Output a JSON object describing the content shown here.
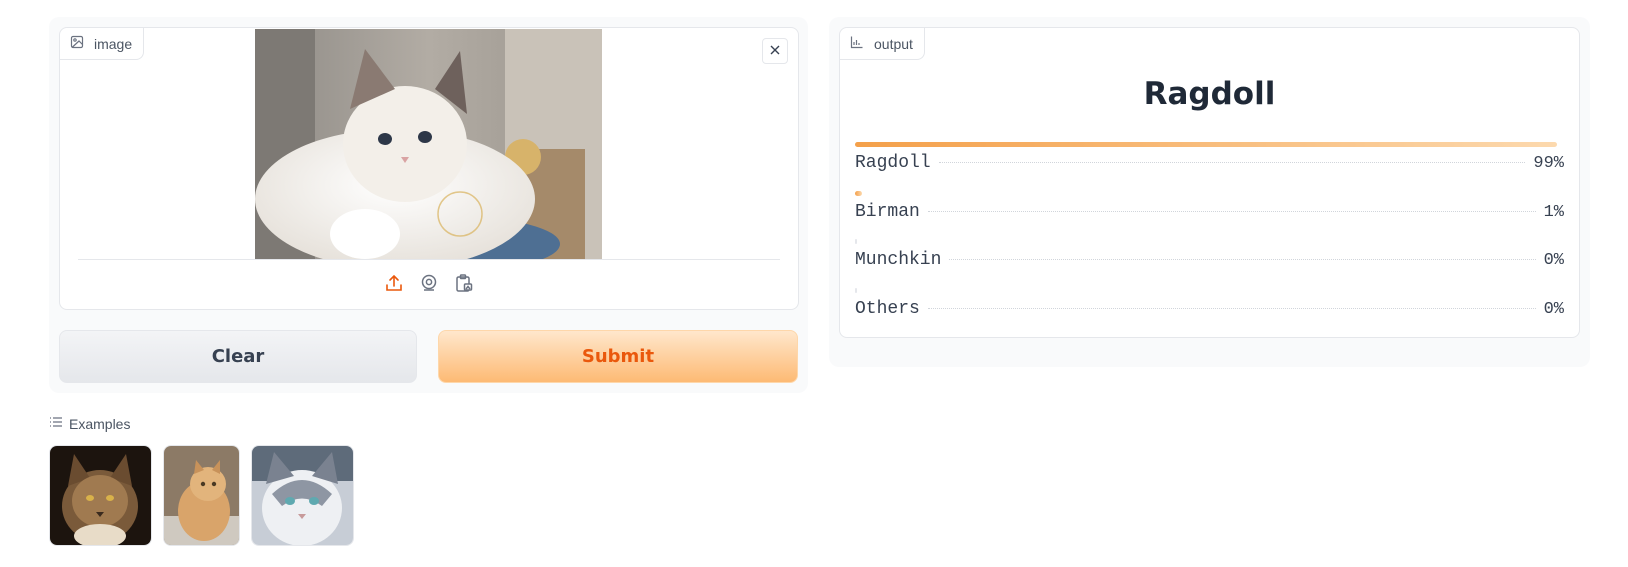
{
  "input": {
    "label": "image",
    "icon": "image-icon",
    "close_icon": "close-icon",
    "source_icons": [
      "upload-icon",
      "webcam-icon",
      "clipboard-icon"
    ]
  },
  "buttons": {
    "clear_label": "Clear",
    "submit_label": "Submit"
  },
  "output": {
    "label": "output",
    "icon": "chart-icon",
    "top_label": "Ragdoll",
    "confidences": [
      {
        "label": "Ragdoll",
        "value": "99%",
        "fraction": 0.99
      },
      {
        "label": "Birman",
        "value": "1%",
        "fraction": 0.01
      },
      {
        "label": "Munchkin",
        "value": "0%",
        "fraction": 0.0
      },
      {
        "label": "Others",
        "value": "0%",
        "fraction": 0.0
      }
    ]
  },
  "examples": {
    "label": "Examples",
    "icon": "list-icon",
    "items": [
      "maine-coon-thumbnail",
      "persian-cat-thumbnail",
      "ragdoll-cat-thumbnail"
    ]
  },
  "colors": {
    "accent": "#ea580c",
    "bar_start": "#f4a04a",
    "bar_end": "#fcd9ae"
  }
}
